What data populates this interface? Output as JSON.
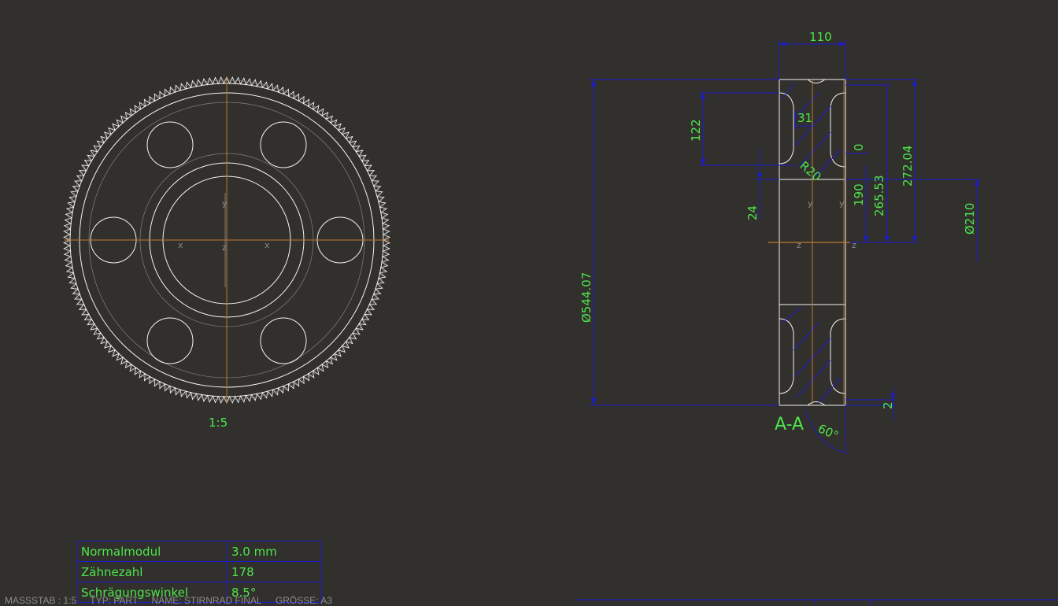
{
  "front_view": {
    "scale_label": "1:5"
  },
  "section_view": {
    "title": "A-A",
    "dims": {
      "width": "110",
      "outer_diameter": "Ø544.07",
      "web_offset": "122",
      "small_width": "31",
      "radius": "R20",
      "zero": "0",
      "hub_step": "24",
      "hub_height": "190",
      "root_radius": "265.53",
      "tip_radius": "272.04",
      "bore_diameter": "Ø210",
      "chamfer": "2",
      "angle": "60°"
    },
    "axis_labels": {
      "x": "x",
      "y": "y",
      "z": "z"
    }
  },
  "properties": [
    {
      "key": "Normalmodul",
      "value": "3.0  mm"
    },
    {
      "key": "Zähnezahl",
      "value": "178"
    },
    {
      "key": "Schrägungswinkel",
      "value": "8.5°"
    }
  ],
  "footer": {
    "scale": "MASSSTAB : 1:5",
    "type": "TYP: PART",
    "name": "NAME: STIRNRAD FINAL",
    "size": "GRÖSSE: A3"
  },
  "colors": {
    "background": "#32302c",
    "geometry": "#f2f2f2",
    "dimension_line": "#1c1cd0",
    "dimension_text": "#4de64d",
    "centerline": "#c07830",
    "thin_circle": "#808080"
  }
}
